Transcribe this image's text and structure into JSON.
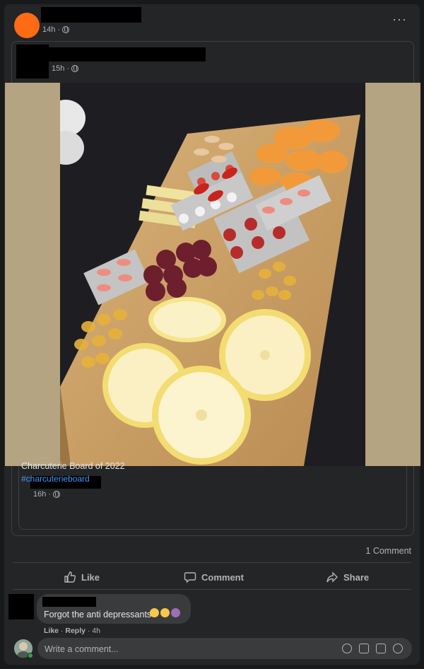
{
  "post": {
    "time": "14h ·",
    "shared": {
      "time": "15h ·",
      "inner_time": "16h ·",
      "text": "Charcuterie Board of 2022",
      "hashtag": "#charcuterieboard"
    },
    "comment_count": "1 Comment"
  },
  "actions": {
    "like": "Like",
    "comment": "Comment",
    "share": "Share"
  },
  "comment": {
    "text": "Forgot the anti depressants",
    "like": "Like",
    "reply": "Reply",
    "time": "4h",
    "actions_sep": " · "
  },
  "composer": {
    "placeholder": "Write a comment..."
  },
  "colors": {
    "accent_link": "#4599ff",
    "avatar": "#ff6a14"
  }
}
